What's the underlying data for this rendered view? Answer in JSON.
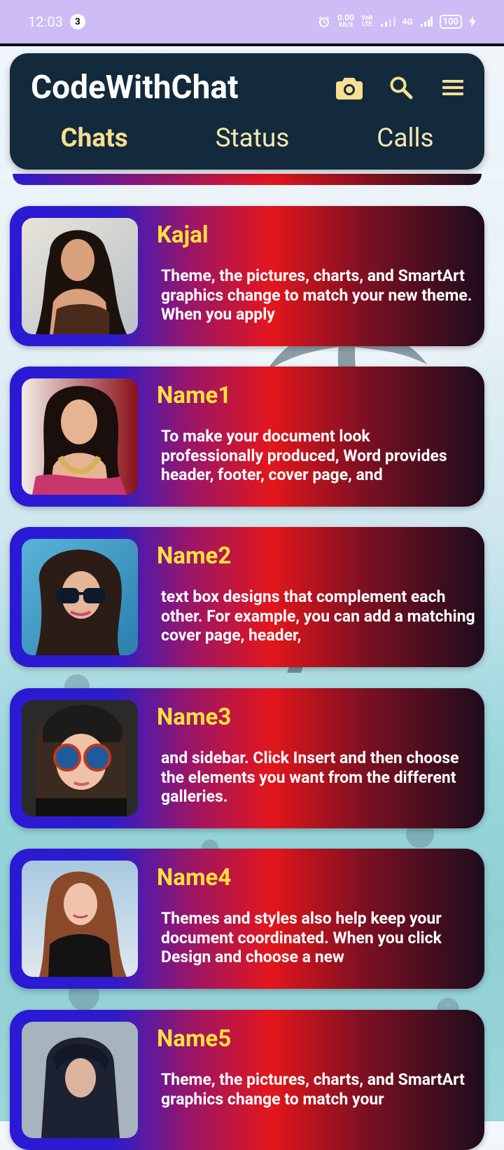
{
  "status_bar": {
    "time": "12:03",
    "notification_count": "3",
    "net_speed_value": "0.00",
    "net_speed_unit": "KB/S",
    "volte_line1": "VoB",
    "volte_line2": "LTE",
    "network_type": "4G",
    "battery": "100"
  },
  "app_bar": {
    "title": "CodeWithChat",
    "icons": [
      "camera-icon",
      "search-icon",
      "menu-icon"
    ]
  },
  "tabs": [
    {
      "label": "Chats",
      "active": true
    },
    {
      "label": "Status",
      "active": false
    },
    {
      "label": "Calls",
      "active": false
    }
  ],
  "chats": [
    {
      "name": "Kajal",
      "message": "Theme, the pictures, charts, and SmartArt graphics change to match your new theme. When you apply"
    },
    {
      "name": "Name1",
      "message": "To make your document look professionally produced, Word provides header, footer, cover page, and"
    },
    {
      "name": "Name2",
      "message": "text box designs that complement each other. For example, you can add a matching cover page, header,"
    },
    {
      "name": "Name3",
      "message": "and sidebar. Click Insert and then choose the elements you want from the different galleries."
    },
    {
      "name": "Name4",
      "message": "Themes and styles also help keep your document coordinated. When you click Design and choose a new"
    },
    {
      "name": "Name5",
      "message": "Theme, the pictures, charts, and SmartArt graphics change to match your"
    }
  ],
  "colors": {
    "status_bar_bg": "#cdbcf6",
    "app_bar_bg": "#132a3c",
    "tab_text": "#f7df91",
    "chat_name": "#ffe03e",
    "chat_message": "#ffffff",
    "card_gradient": [
      "#2a1ad6",
      "#e3161c",
      "#1d0c1c"
    ]
  }
}
